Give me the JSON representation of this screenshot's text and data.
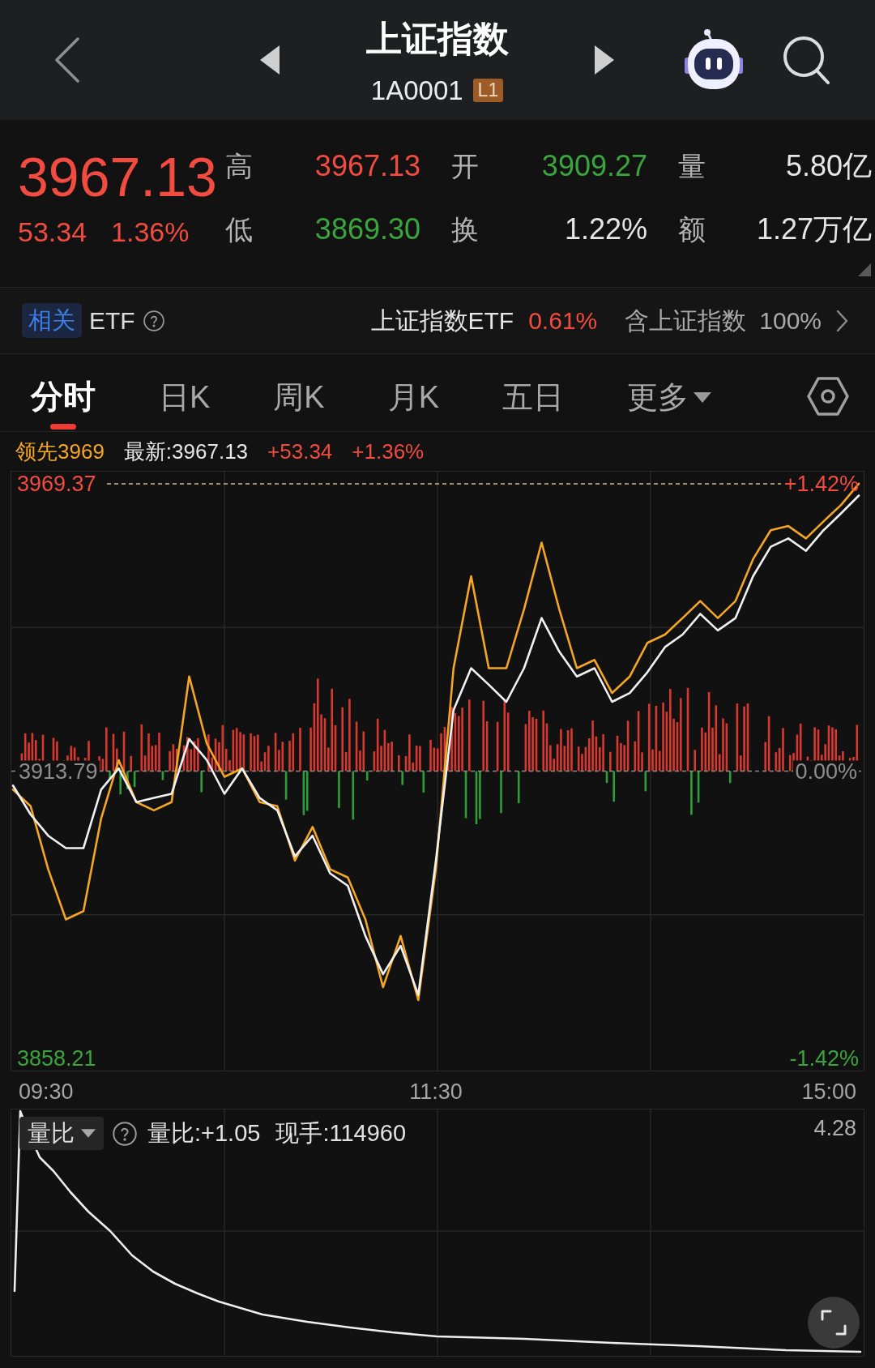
{
  "header": {
    "title": "上证指数",
    "code": "1A0001",
    "level_badge": "L1"
  },
  "quote": {
    "price": "3967.13",
    "change": "53.34",
    "change_percent": "1.36%",
    "stats": [
      {
        "label": "高",
        "value": "3967.13",
        "color": "#f24b3f"
      },
      {
        "label": "开",
        "value": "3909.27",
        "color": "#3ba53d"
      },
      {
        "label": "量",
        "value": "5.80亿",
        "color": "#e6e6e6"
      },
      {
        "label": "低",
        "value": "3869.30",
        "color": "#3ba53d"
      },
      {
        "label": "换",
        "value": "1.22%",
        "color": "#e6e6e6"
      },
      {
        "label": "额",
        "value": "1.27万亿",
        "color": "#e6e6e6"
      }
    ]
  },
  "related_etf": {
    "tag": "相关",
    "label": "ETF",
    "fund_name": "上证指数ETF",
    "fund_change": "0.61%",
    "holding_label": "含上证指数",
    "holding": "100%"
  },
  "tabs": [
    {
      "label": "分时",
      "kind": "tab",
      "selected": true
    },
    {
      "label": "日K",
      "kind": "tab",
      "selected": false
    },
    {
      "label": "周K",
      "kind": "tab",
      "selected": false
    },
    {
      "label": "月K",
      "kind": "tab",
      "selected": false
    },
    {
      "label": "五日",
      "kind": "tab",
      "selected": false
    },
    {
      "label": "更多",
      "kind": "dropdown",
      "selected": false
    }
  ],
  "legend": [
    {
      "text": "领先3969",
      "color": "#f5a623"
    },
    {
      "text": "最新:3967.13",
      "color": "#e6e6e6"
    },
    {
      "text": "+53.34",
      "color": "#f24b3f"
    },
    {
      "text": "+1.36%",
      "color": "#f24b3f"
    }
  ],
  "intraday_chart": {
    "chart_data": {
      "type": "line",
      "categories": [
        null,
        null,
        null,
        null,
        null,
        null,
        null,
        null,
        null,
        null,
        null,
        null,
        null,
        null,
        null,
        null,
        null,
        null,
        null,
        null,
        null,
        null,
        null,
        null,
        null,
        null,
        null,
        null,
        null,
        null,
        null,
        null,
        null,
        null,
        null,
        null,
        null,
        null,
        null,
        null,
        null,
        null,
        null,
        null,
        null,
        null,
        null,
        null,
        null
      ],
      "ylim": [
        3855.86,
        3971.72
      ],
      "yticks": [
        {
          "value": 3969.37,
          "label": "3969.37"
        },
        {
          "value": 3913.79,
          "label": "3913.79"
        },
        {
          "value": 3858.21,
          "label": "3858.21"
        }
      ],
      "series": [
        {
          "color": "#f2f2f2",
          "values": [
            3911.0,
            3905.4,
            3901.3,
            3898.9,
            3898.9,
            3910.2,
            3914.3,
            3907.8,
            3908.6,
            3909.4,
            3920.0,
            3915.9,
            3909.4,
            3914.3,
            3908.6,
            3906.2,
            3897.3,
            3901.3,
            3894.0,
            3891.6,
            3881.9,
            3874.5,
            3880.0,
            3870.5,
            3896.5,
            3925.6,
            3933.7,
            3930.5,
            3927.2,
            3933.7,
            3943.4,
            3936.9,
            3932.1,
            3933.7,
            3927.2,
            3928.9,
            3932.9,
            3937.8,
            3940.2,
            3944.2,
            3941.0,
            3943.4,
            3951.5,
            3957.2,
            3958.8,
            3956.4,
            3960.4,
            3963.7,
            3967.1
          ]
        },
        {
          "color": "#f5a623",
          "values": [
            3910.2,
            3907.0,
            3894.8,
            3885.1,
            3886.7,
            3904.6,
            3915.9,
            3907.8,
            3906.2,
            3907.8,
            3932.1,
            3919.1,
            3912.7,
            3914.3,
            3907.8,
            3907.0,
            3896.5,
            3903.0,
            3894.8,
            3893.2,
            3885.1,
            3872.0,
            3881.9,
            3869.5,
            3894.8,
            3933.7,
            3951.5,
            3933.7,
            3933.7,
            3945.1,
            3958.0,
            3945.1,
            3933.7,
            3935.3,
            3928.9,
            3932.1,
            3938.6,
            3940.2,
            3943.4,
            3946.7,
            3943.4,
            3946.7,
            3954.8,
            3960.4,
            3961.2,
            3958.8,
            3962.1,
            3965.3,
            3969.4
          ]
        }
      ]
    },
    "percent_labels": [
      "+1.42%",
      "0.00%",
      "-1.42%"
    ],
    "time_labels": [
      "09:30",
      "11:30",
      "15:00"
    ]
  },
  "volume_ratio_panel": {
    "selector": "量比",
    "ratio": "量比:+1.05",
    "current_volume": "现手:114960",
    "max_label": "4.28"
  }
}
